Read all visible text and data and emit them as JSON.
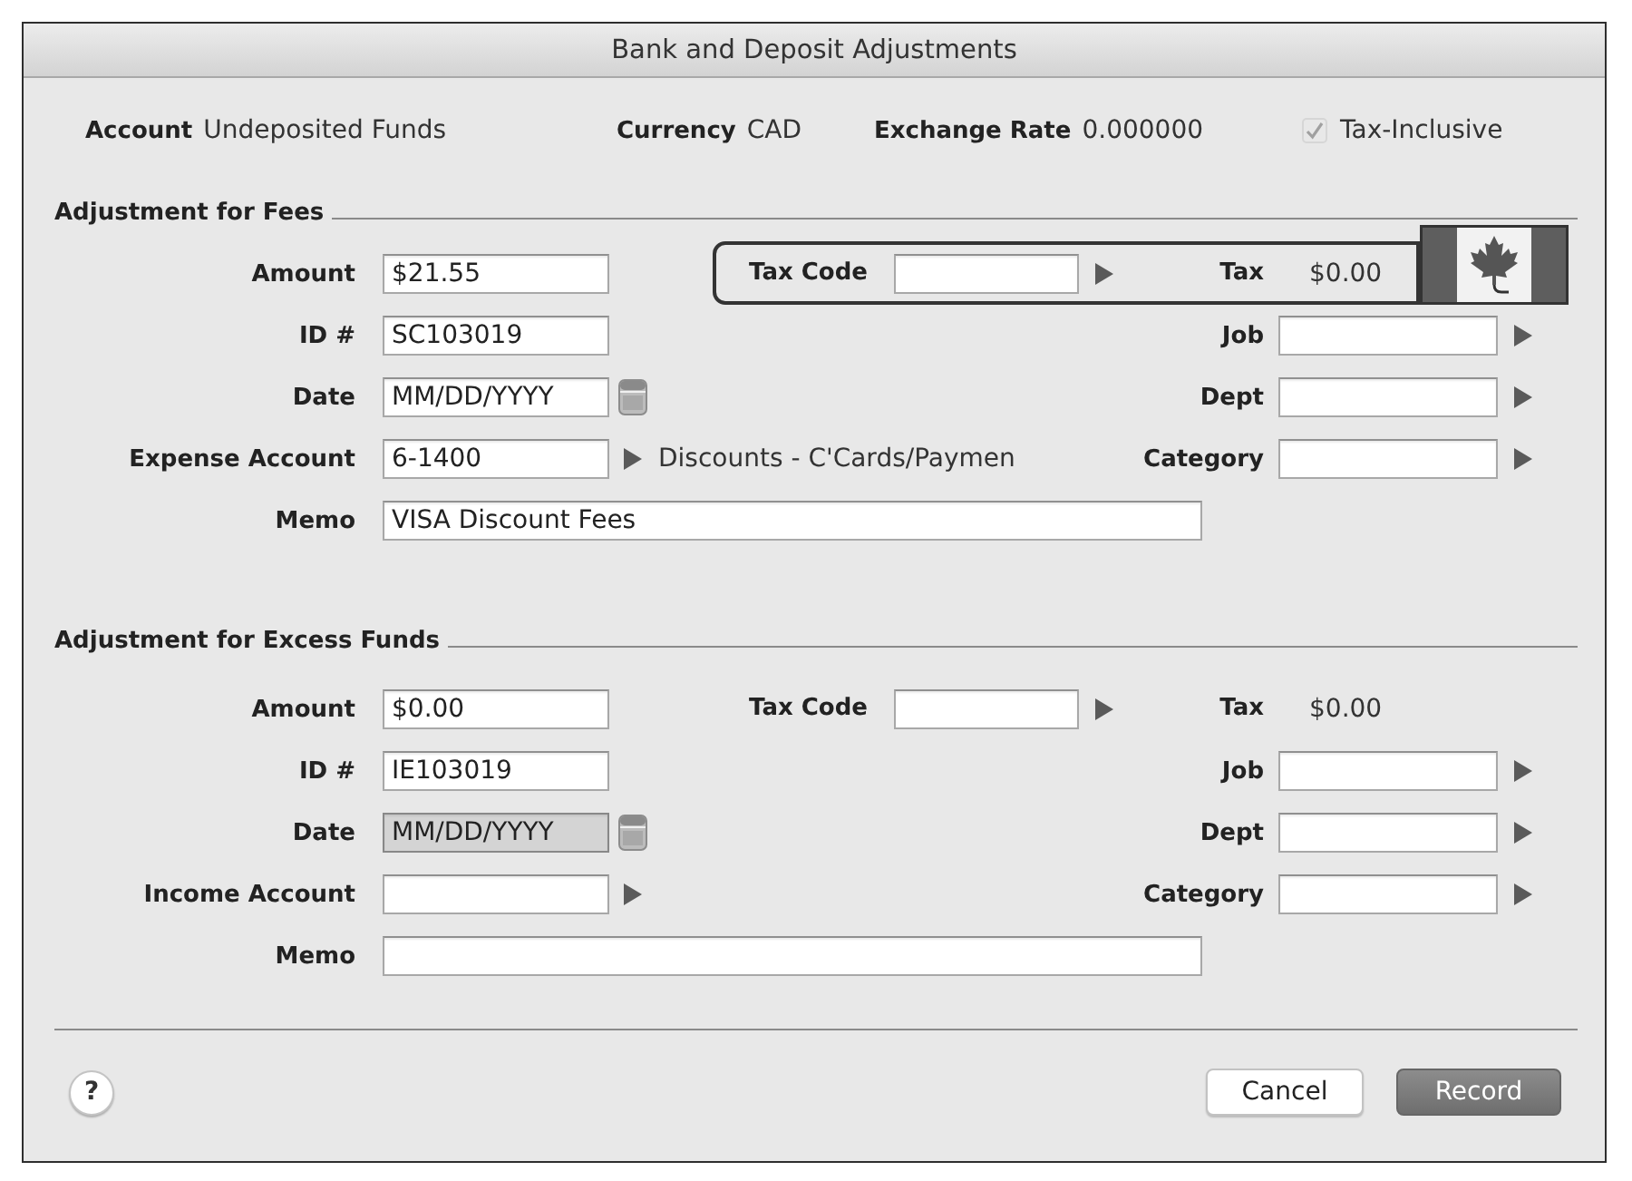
{
  "window": {
    "title": "Bank and Deposit Adjustments"
  },
  "header": {
    "fields": [
      {
        "label": "Account",
        "value": "Undeposited Funds"
      },
      {
        "label": "Currency",
        "value": "CAD"
      },
      {
        "label": "Exchange Rate",
        "value": "0.000000"
      }
    ],
    "tax_inclusive": {
      "label": "Tax-Inclusive",
      "checked": true
    }
  },
  "sections": [
    {
      "title": "Adjustment for Fees",
      "amount": {
        "label": "Amount",
        "value": "$21.55"
      },
      "id": {
        "label": "ID #",
        "value": "SC103019"
      },
      "date": {
        "label": "Date",
        "placeholder": "MM/DD/YYYY",
        "disabled": false
      },
      "account": {
        "label": "Expense Account",
        "value": "6-1400",
        "name": "Discounts - C'Cards/Paymen"
      },
      "memo": {
        "label": "Memo",
        "value": "VISA Discount Fees"
      },
      "tax": {
        "code_label": "Tax Code",
        "tax_label": "Tax",
        "tax_value": "$0.00",
        "highlighted": true
      },
      "lookups": [
        {
          "label": "Job"
        },
        {
          "label": "Dept"
        },
        {
          "label": "Category"
        }
      ]
    },
    {
      "title": "Adjustment for Excess Funds",
      "amount": {
        "label": "Amount",
        "value": "$0.00"
      },
      "id": {
        "label": "ID #",
        "value": "IE103019"
      },
      "date": {
        "label": "Date",
        "placeholder": "MM/DD/YYYY",
        "disabled": true
      },
      "account": {
        "label": "Income Account"
      },
      "memo": {
        "label": "Memo"
      },
      "tax": {
        "code_label": "Tax Code",
        "tax_label": "Tax",
        "tax_value": "$0.00",
        "highlighted": false
      },
      "lookups": [
        {
          "label": "Job"
        },
        {
          "label": "Dept"
        },
        {
          "label": "Category"
        }
      ]
    }
  ],
  "help_button": {
    "label": "?"
  },
  "buttons": [
    {
      "label": "Cancel",
      "default": false
    },
    {
      "label": "Record",
      "default": true
    }
  ]
}
